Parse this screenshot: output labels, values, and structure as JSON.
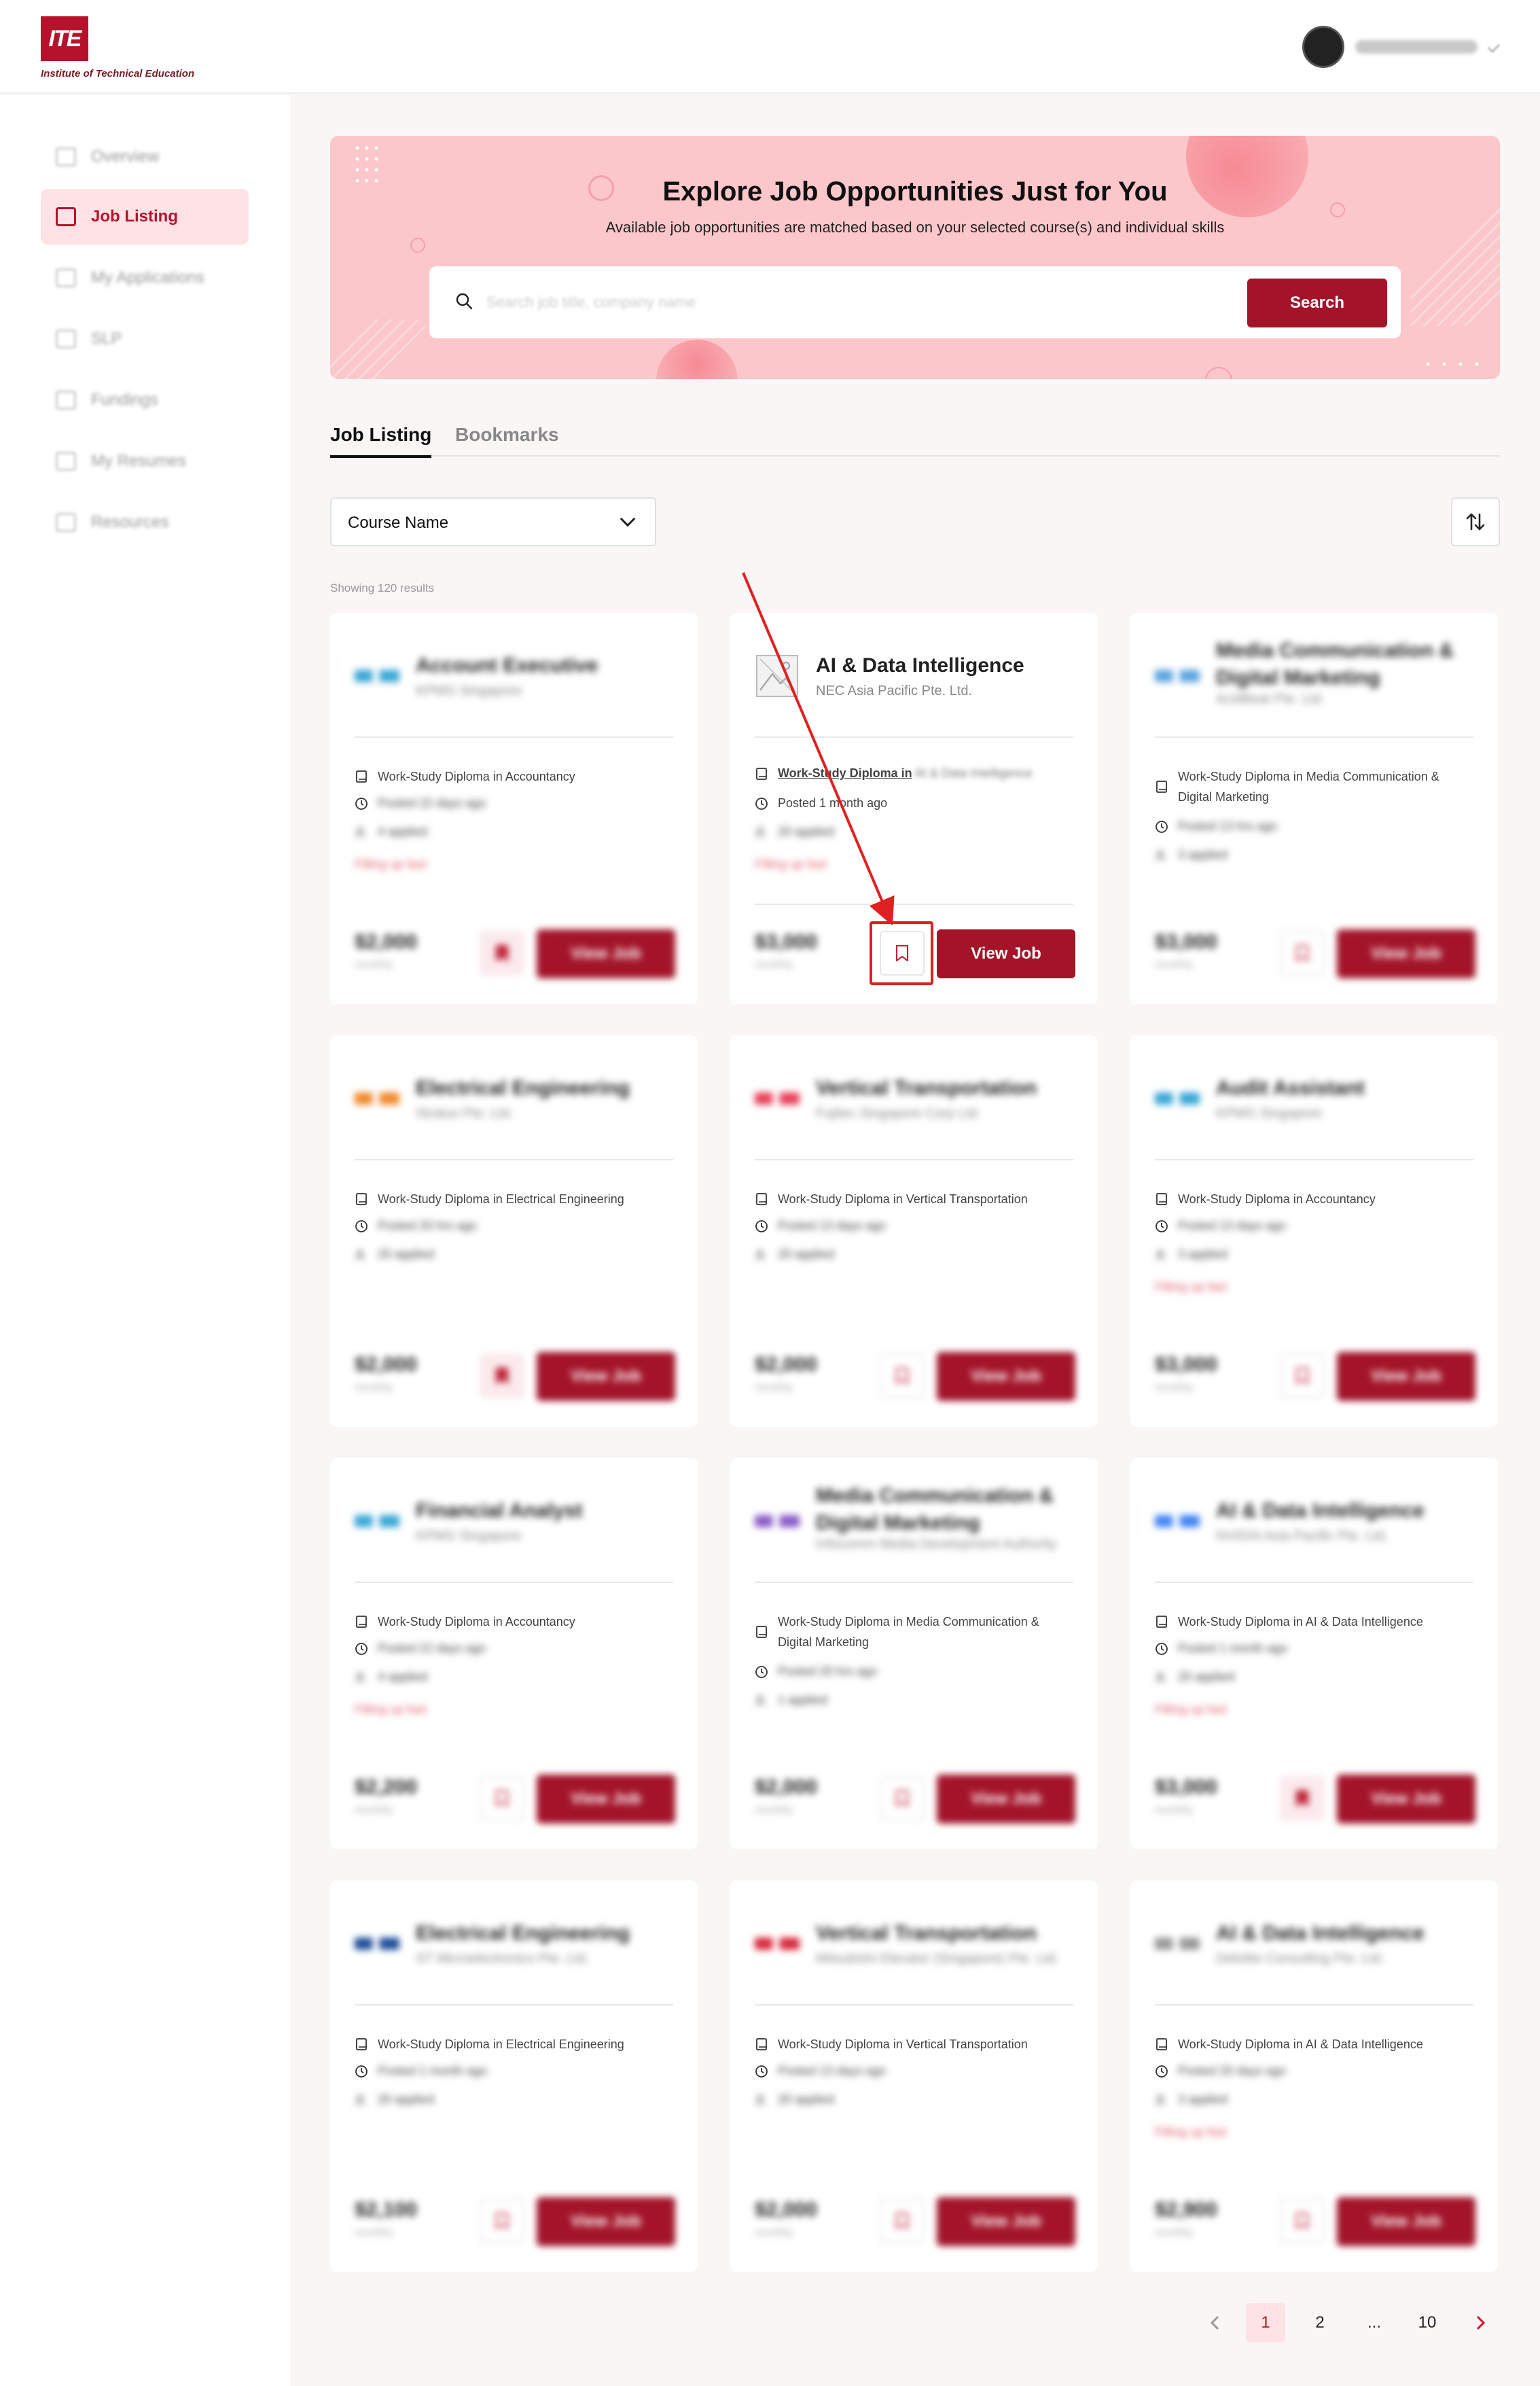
{
  "app": {
    "logo_mark": "ITE",
    "logo_text": "Institute of Technical Education"
  },
  "user": {
    "name": "Daniel Wong Jie Hong"
  },
  "sidebar": {
    "items": [
      {
        "label": "Overview",
        "icon": "grid-icon",
        "active": false
      },
      {
        "label": "Job Listing",
        "icon": "briefcase-icon",
        "active": true
      },
      {
        "label": "My Applications",
        "icon": "document-icon",
        "active": false
      },
      {
        "label": "SLP",
        "icon": "calendar-icon",
        "active": false
      },
      {
        "label": "Fundings",
        "icon": "money-icon",
        "active": false
      },
      {
        "label": "My Resumes",
        "icon": "resume-icon",
        "active": false
      },
      {
        "label": "Resources",
        "icon": "book-icon",
        "active": false
      }
    ]
  },
  "hero": {
    "title": "Explore Job Opportunities Just for You",
    "subtitle": "Available job opportunities are matched based on your selected course(s) and individual skills",
    "search_placeholder": "Search job title, company name",
    "search_button": "Search"
  },
  "tabs": [
    {
      "label": "Job Listing",
      "active": true
    },
    {
      "label": "Bookmarks",
      "active": false
    }
  ],
  "filter": {
    "course_label": "Course Name"
  },
  "results_text": "Showing 120 results",
  "cards": [
    {
      "title": "Account Executive",
      "company": "KPMG Singapore",
      "course": "Work-Study Diploma in Accountancy",
      "posted": "Posted 22 days ago",
      "applied": "4 applied",
      "hiring": "Filling up fast",
      "salary": "$2,000",
      "unit": "monthly",
      "bookmarked": true,
      "view": "View Job",
      "logo_color": "#3aa7d6"
    },
    {
      "title": "AI & Data Intelligence",
      "company": "NEC Asia Pacific Pte. Ltd.",
      "course": "Work-Study Diploma in AI & Data Intelligence",
      "course_prefix": "Work-Study Diploma in",
      "posted": "Posted 1 month ago",
      "applied": "20 applied",
      "hiring": "Filling up fast",
      "salary": "$3,000",
      "unit": "monthly",
      "bookmarked": false,
      "view": "View Job",
      "logo_color": "#cccccc",
      "focus": true
    },
    {
      "title": "Media Communication & Digital Marketing",
      "company": "AcidBeat Pte. Ltd.",
      "course": "Work-Study Diploma in Media Communication & Digital Marketing",
      "posted": "Posted 13 hrs ago",
      "applied": "3 applied",
      "hiring": "",
      "salary": "$3,000",
      "unit": "monthly",
      "bookmarked": false,
      "view": "View Job",
      "logo_color": "#5aa4e0"
    },
    {
      "title": "Electrical Engineering",
      "company": "Stratus Pte. Ltd.",
      "course": "Work-Study Diploma in Electrical Engineering",
      "posted": "Posted 20 hrs ago",
      "applied": "20 applied",
      "hiring": "",
      "salary": "$2,000",
      "unit": "monthly",
      "bookmarked": true,
      "view": "View Job",
      "logo_color": "#f08a2c"
    },
    {
      "title": "Vertical Transportation",
      "company": "Fujitec Singapore Corp Ltd",
      "course": "Work-Study Diploma in Vertical Transportation",
      "posted": "Posted 13 days ago",
      "applied": "20 applied",
      "hiring": "",
      "salary": "$2,000",
      "unit": "monthly",
      "bookmarked": false,
      "view": "View Job",
      "logo_color": "#e8405a"
    },
    {
      "title": "Audit Assistant",
      "company": "KPMG Singapore",
      "course": "Work-Study Diploma in Accountancy",
      "posted": "Posted 13 days ago",
      "applied": "3 applied",
      "hiring": "Filling up fast",
      "salary": "$3,000",
      "unit": "monthly",
      "bookmarked": false,
      "view": "View Job",
      "logo_color": "#3aa7d6"
    },
    {
      "title": "Financial Analyst",
      "company": "KPMG Singapore",
      "course": "Work-Study Diploma in Accountancy",
      "posted": "Posted 22 days ago",
      "applied": "4 applied",
      "hiring": "Filling up fast",
      "salary": "$2,200",
      "unit": "monthly",
      "bookmarked": false,
      "view": "View Job",
      "logo_color": "#3aa7d6"
    },
    {
      "title": "Media Communication & Digital Marketing",
      "company": "Infocomm Media Development Authority",
      "course": "Work-Study Diploma in Media Communication & Digital Marketing",
      "posted": "Posted 20 hrs ago",
      "applied": "1 applied",
      "hiring": "",
      "salary": "$2,000",
      "unit": "monthly",
      "bookmarked": false,
      "view": "View Job",
      "logo_color": "#8a5cc8"
    },
    {
      "title": "AI & Data Intelligence",
      "company": "NVIDIA Asia Pacific Pte. Ltd.",
      "course": "Work-Study Diploma in AI & Data Intelligence",
      "posted": "Posted 1 month ago",
      "applied": "20 applied",
      "hiring": "Filling up fast",
      "salary": "$3,000",
      "unit": "monthly",
      "bookmarked": true,
      "view": "View Job",
      "logo_color": "#4285f4"
    },
    {
      "title": "Electrical Engineering",
      "company": "ST Microelectronics Pte. Ltd.",
      "course": "Work-Study Diploma in Electrical Engineering",
      "posted": "Posted 1 month ago",
      "applied": "20 applied",
      "hiring": "",
      "salary": "$2,100",
      "unit": "monthly",
      "bookmarked": false,
      "view": "View Job",
      "logo_color": "#1f4e9a"
    },
    {
      "title": "Vertical Transportation",
      "company": "Mitsubishi Elevator (Singapore) Pte. Ltd.",
      "course": "Work-Study Diploma in Vertical Transportation",
      "posted": "Posted 13 days ago",
      "applied": "20 applied",
      "hiring": "",
      "salary": "$2,000",
      "unit": "monthly",
      "bookmarked": false,
      "view": "View Job",
      "logo_color": "#d8283c"
    },
    {
      "title": "AI & Data Intelligence",
      "company": "Deloitte Consulting Pte. Ltd.",
      "course": "Work-Study Diploma in AI & Data Intelligence",
      "posted": "Posted 20 days ago",
      "applied": "3 applied",
      "hiring": "Filling up fast",
      "salary": "$2,900",
      "unit": "monthly",
      "bookmarked": false,
      "view": "View Job",
      "logo_color": "#999999"
    }
  ],
  "pagination": {
    "prev_icon": "chevron-left-icon",
    "pages": [
      "1",
      "2",
      "...",
      "10"
    ],
    "current": "1",
    "next_icon": "chevron-right-icon"
  },
  "colors": {
    "brand": "#a31429",
    "hero_bg": "#fcc7ca",
    "annotation": "#e02020"
  }
}
